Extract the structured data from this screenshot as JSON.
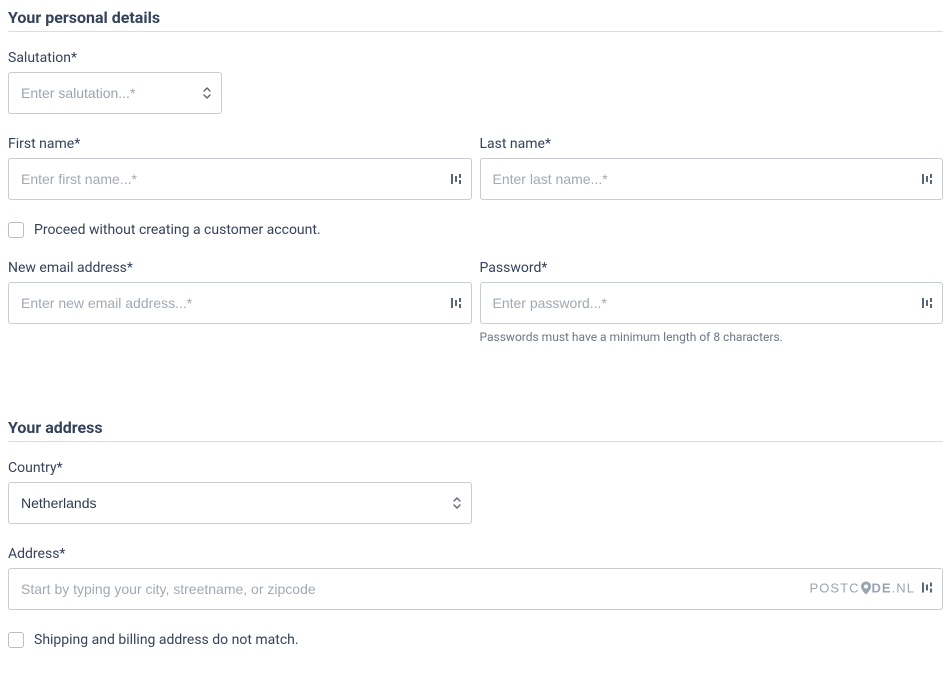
{
  "personal": {
    "heading": "Your personal details",
    "salutation": {
      "label": "Salutation*",
      "placeholder": "Enter salutation...*",
      "value": ""
    },
    "first_name": {
      "label": "First name*",
      "placeholder": "Enter first name...*",
      "value": ""
    },
    "last_name": {
      "label": "Last name*",
      "placeholder": "Enter last name...*",
      "value": ""
    },
    "guest_checkbox": {
      "label": "Proceed without creating a customer account.",
      "checked": false
    },
    "email": {
      "label": "New email address*",
      "placeholder": "Enter new email address...*",
      "value": ""
    },
    "password": {
      "label": "Password*",
      "placeholder": "Enter password...*",
      "value": "",
      "hint": "Passwords must have a minimum length of 8 characters."
    }
  },
  "address": {
    "heading": "Your address",
    "country": {
      "label": "Country*",
      "value": "Netherlands"
    },
    "address_field": {
      "label": "Address*",
      "placeholder": "Start by typing your city, streetname, or zipcode",
      "value": "",
      "provider_logo": {
        "prefix": "POSTC",
        "middle": "DE",
        "suffix": ".NL"
      }
    },
    "different_billing_checkbox": {
      "label": "Shipping and billing address do not match.",
      "checked": false
    }
  }
}
